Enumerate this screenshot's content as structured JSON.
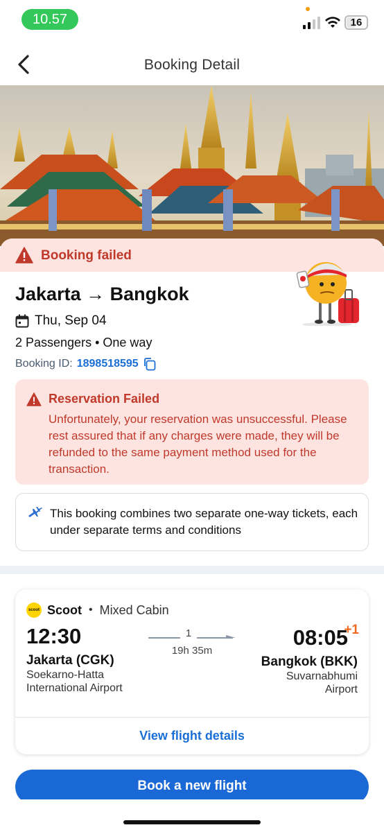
{
  "status_bar": {
    "time": "10.57",
    "battery": "16"
  },
  "header": {
    "title": "Booking Detail",
    "back_icon": "chevron-left-icon"
  },
  "booking": {
    "status_label": "Booking failed",
    "route_title": "Jakarta → Bangkok",
    "date": "Thu, Sep 04",
    "passengers": "2 Passengers",
    "trip_type": "One way",
    "booking_id_label": "Booking ID:",
    "booking_id": "1898518595"
  },
  "alert": {
    "title": "Reservation Failed",
    "body": "Unfortunately, your reservation was unsuccessful. Please rest assured that if any charges were made, they will be refunded to the same payment method used for the transaction."
  },
  "info": {
    "text": "This booking combines two separate one-way tickets, each under separate terms and conditions"
  },
  "flight": {
    "airline": "Scoot",
    "airline_logo_text": "scoot",
    "cabin": "Mixed Cabin",
    "departure_time": "12:30",
    "arrival_time": "08:05",
    "day_offset": "+1",
    "stops": "1",
    "duration": "19h 35m",
    "departure_city": "Jakarta (CGK)",
    "departure_airport": "Soekarno-Hatta International Airport",
    "arrival_city": "Bangkok (BKK)",
    "arrival_airport": "Suvarnabhumi Airport",
    "view_details_label": "View flight details"
  },
  "actions": {
    "book_new_label": "Book a new flight"
  },
  "colors": {
    "error": "#c0392b",
    "error_bg": "#fde4e1",
    "primary": "#1a68d6",
    "accent": "#f06a1f"
  }
}
